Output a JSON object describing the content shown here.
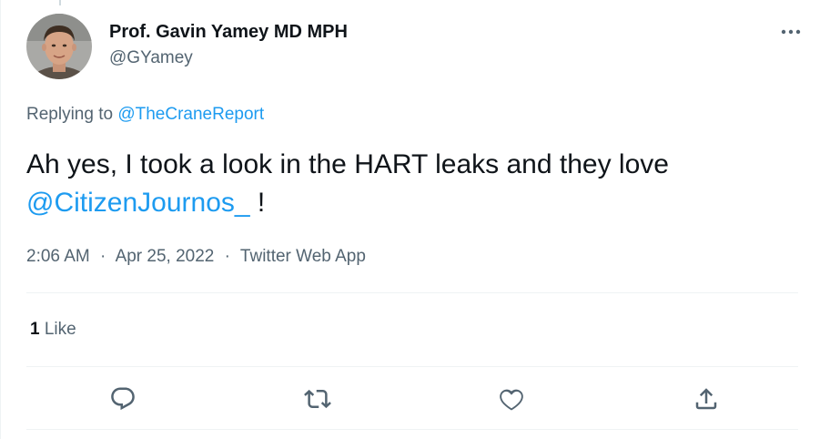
{
  "author": {
    "name": "Prof. Gavin Yamey MD MPH",
    "handle": "@GYamey",
    "avatar_icon": "profile-photo"
  },
  "reply_context": {
    "prefix": "Replying to",
    "mention": "@TheCraneReport"
  },
  "tweet": {
    "text_line1": "Ah yes, I took a look in the HART leaks and they love",
    "mention": "@CitizenJournos_",
    "text_suffix": " !"
  },
  "meta": {
    "time": "2:06 AM",
    "separator": "·",
    "date": "Apr 25, 2022",
    "source": "Twitter Web App"
  },
  "engagement": {
    "likes_count": "1",
    "likes_label": "Like"
  },
  "actions": [
    {
      "name": "reply",
      "icon": "reply-icon"
    },
    {
      "name": "retweet",
      "icon": "retweet-icon"
    },
    {
      "name": "like",
      "icon": "heart-icon"
    },
    {
      "name": "share",
      "icon": "share-icon"
    }
  ],
  "colors": {
    "link": "#1d9bf0",
    "secondary_text": "#536471",
    "primary_text": "#0f1419",
    "divider": "#eff3f4"
  }
}
